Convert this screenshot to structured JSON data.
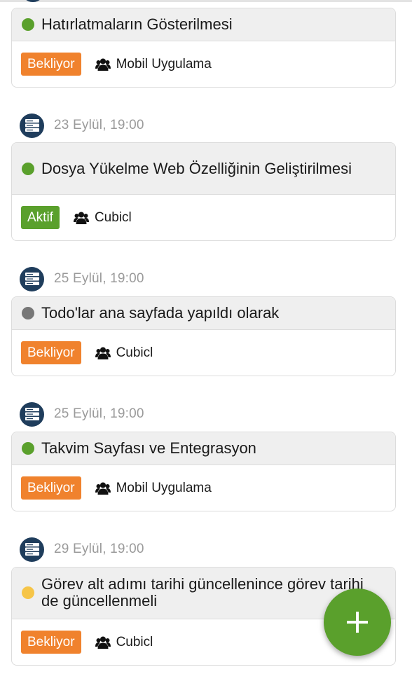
{
  "colors": {
    "navy": "#1f3d5c",
    "status_green": "#5aa02c",
    "status_gray": "#777777",
    "status_yellow": "#f6c548",
    "badge_waiting": "#f0822d",
    "badge_active": "#5aa02c",
    "fab": "#5aa02c"
  },
  "icons": {
    "date": "server-stack-icon",
    "team": "users-icon",
    "fab": "plus-icon"
  },
  "tasks": [
    {
      "date": "",
      "title": "Hatırlatmaların Gösterilmesi",
      "status_color": "green",
      "badge": "Bekliyor",
      "badge_type": "waiting",
      "team": "Mobil Uygulama"
    },
    {
      "date": "23 Eylül, 19:00",
      "title": "Dosya Yükelme Web Özelliğinin Geliştirilmesi",
      "status_color": "green",
      "badge": "Aktif",
      "badge_type": "active",
      "team": "Cubicl"
    },
    {
      "date": "25 Eylül, 19:00",
      "title": "Todo'lar ana sayfada yapıldı olarak",
      "status_color": "gray",
      "badge": "Bekliyor",
      "badge_type": "waiting",
      "team": "Cubicl"
    },
    {
      "date": "25 Eylül, 19:00",
      "title": "Takvim Sayfası ve Entegrasyon",
      "status_color": "green",
      "badge": "Bekliyor",
      "badge_type": "waiting",
      "team": "Mobil Uygulama"
    },
    {
      "date": "29 Eylül, 19:00",
      "title": "Görev alt adımı tarihi güncellenince görev tarihi de güncellenmeli",
      "status_color": "yellow",
      "badge": "Bekliyor",
      "badge_type": "waiting",
      "team": "Cubicl"
    }
  ]
}
